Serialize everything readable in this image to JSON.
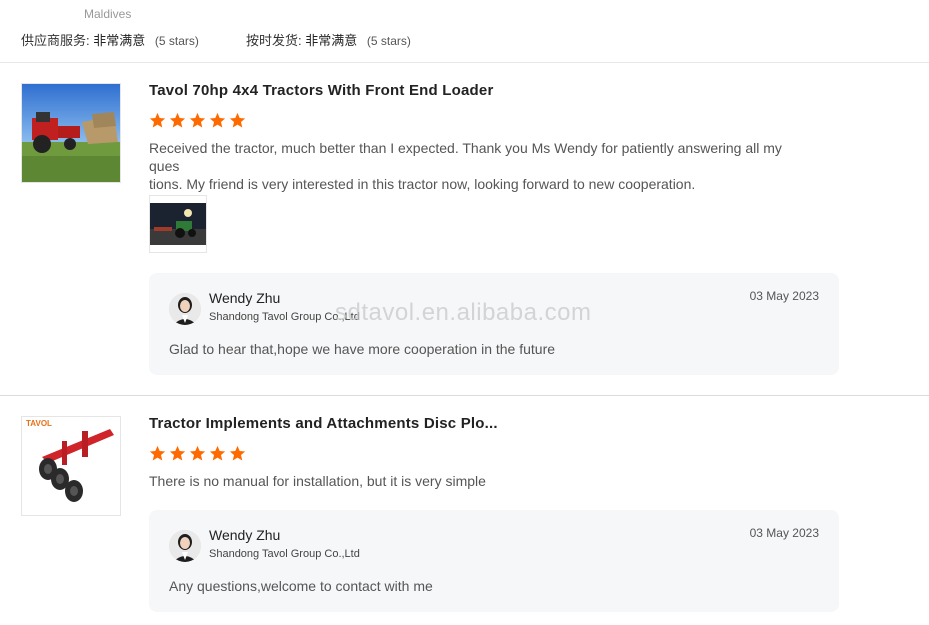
{
  "header": {
    "country": "Maldives",
    "supplier_service": {
      "label": "供应商服务:",
      "value": "非常满意",
      "stars": "(5 stars)"
    },
    "on_time_shipment": {
      "label": "按时发货:",
      "value": "非常满意",
      "stars": "(5 stars)"
    }
  },
  "reviews": [
    {
      "title": "Tavol 70hp 4x4 Tractors With Front End Loader",
      "rating": 5,
      "comment_line1": "Received the tractor, much better than I expected. Thank you Ms Wendy for patiently answering all my ques",
      "comment_line2": "tions. My friend is very interested in this tractor now, looking forward to new cooperation.",
      "reply": {
        "name": "Wendy Zhu",
        "company": "Shandong Tavol Group Co.,Ltd",
        "date": "03 May 2023",
        "text": "Glad to hear that,hope we have more cooperation in the future"
      }
    },
    {
      "title": "Tractor Implements and Attachments Disc Plo...",
      "rating": 5,
      "comment_line1": "There is no manual for installation, but it is very simple",
      "thumb_logo": "TAVOL",
      "reply": {
        "name": "Wendy Zhu",
        "company": "Shandong Tavol Group Co.,Ltd",
        "date": "03 May 2023",
        "text": "Any questions,welcome to contact with me"
      }
    }
  ],
  "watermark": "sdtavol.en.alibaba.com",
  "colors": {
    "star": "#ff6a00",
    "reply_bg": "#f6f7f9",
    "divider": "#e8e8e8"
  }
}
